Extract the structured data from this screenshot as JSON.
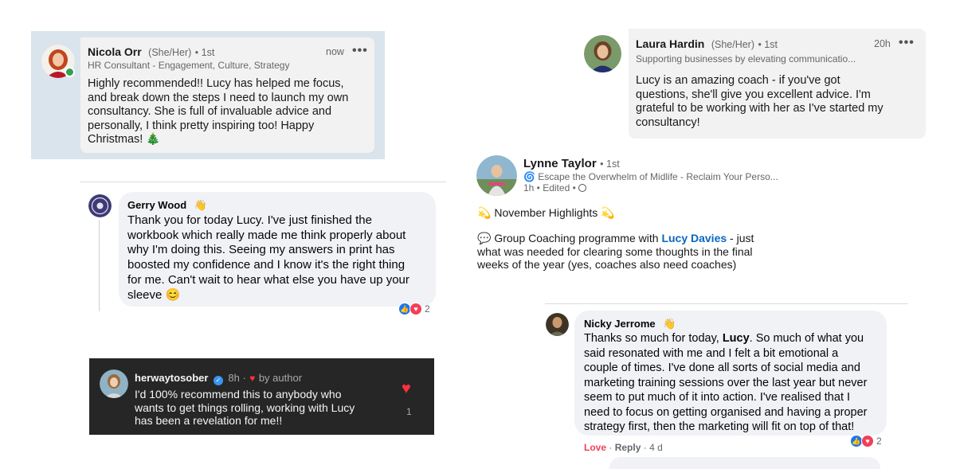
{
  "nicola": {
    "name": "Nicola Orr",
    "pronouns": "(She/Her)",
    "degree": "• 1st",
    "headline": "HR Consultant - Engagement, Culture, Strategy",
    "time": "now",
    "more": "•••",
    "lines": [
      "Highly recommended!! Lucy has helped me focus,",
      "and break down the steps I need to launch my own",
      "consultancy. She is full of invaluable advice and",
      "personally, I think pretty inspiring too! Happy",
      "Christmas! 🎄"
    ]
  },
  "laura": {
    "name": "Laura Hardin",
    "pronouns": "(She/Her)",
    "degree": "• 1st",
    "headline": "Supporting businesses by elevating communicatio...",
    "time": "20h",
    "more": "•••",
    "lines": [
      "Lucy is an amazing coach - if you've got",
      "questions, she'll give you excellent advice.  I'm",
      "grateful to be working with her as I've started my",
      "consultancy!"
    ]
  },
  "gerry": {
    "name": "Gerry Wood",
    "badge": "👋",
    "lines": [
      "Thank you for today Lucy. I've just finished the",
      "workbook which really made me think properly about",
      "why I'm doing this. Seeing my answers in print has",
      "boosted my confidence and I know it's the right thing",
      "for me. Can't wait to hear what else you have up your",
      "sleeve 😊"
    ],
    "reactions": "2"
  },
  "ig": {
    "username": "herwaytosober",
    "time": "8h ·",
    "by_author": "by author",
    "lines": [
      "I'd 100% recommend this to anybody who",
      "wants to get things rolling, working with Lucy",
      "has been a revelation for me!!"
    ],
    "likes": "1"
  },
  "lynne": {
    "name": "Lynne Taylor",
    "degree": "• 1st",
    "headline": "Escape the Overwhelm of Midlife - Reclaim Your Perso...",
    "meta": "1h • Edited •",
    "highlights": "November Highlights",
    "para_prefix": "Group Coaching programme with",
    "mention": "Lucy Davies",
    "para_rest1": " - just",
    "para_line2": "what was needed for clearing some thoughts in the final",
    "para_line3": "weeks of the year (yes, coaches also need coaches)"
  },
  "nicky": {
    "name": "Nicky Jerrome",
    "badge": "👋",
    "line1_prefix": "Thanks so much for today, ",
    "line1_bold": "Lucy",
    "line1_suffix": ". So much of what you",
    "lines": [
      "said resonated with me and I felt a bit emotional a",
      "couple of times. I've done all sorts of social media and",
      "marketing training sessions over the last year but never",
      "seem to put much of it into action. I've realised that I",
      "need to focus on getting organised and having a proper",
      "strategy first, then the marketing will fit on top of that!"
    ],
    "love": "Love",
    "reply": "Reply",
    "age": "· 4 d",
    "reactions": "2"
  },
  "colors": {
    "linkedin_bg": "#d9e4ec",
    "bubble": "#f2f2f2",
    "facebook_bubble": "#f0f2f5",
    "instagram_bg": "#262626",
    "like_blue": "#1877f2",
    "love_red": "#f33e58",
    "link_blue": "#0a66c2"
  }
}
